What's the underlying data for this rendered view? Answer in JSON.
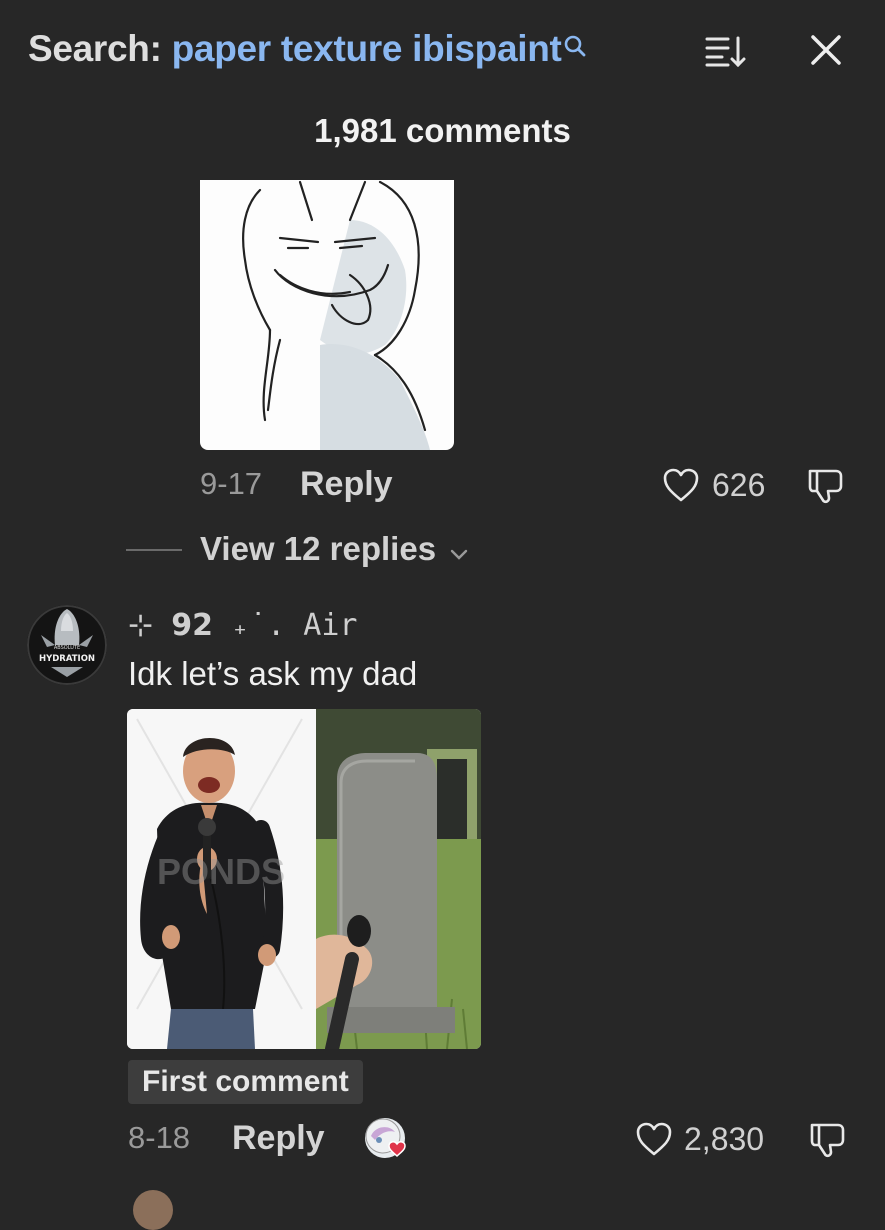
{
  "header": {
    "search_prefix": "Search:",
    "search_query": "paper texture ibispaint",
    "search_icon": "search-icon",
    "sort_icon": "sort-icon",
    "close_icon": "close-icon",
    "comment_count": "1,981 comments"
  },
  "colors": {
    "background": "#272727",
    "query_link": "#8ab7f0",
    "secondary_text": "#9a9a9a",
    "badge_bg": "#3d3d3d"
  },
  "comment1": {
    "date": "9-17",
    "reply_label": "Reply",
    "likes": "626",
    "view_replies": "View 12 replies"
  },
  "comment2": {
    "username": "⊹ 𝟵𝟮 ₊˙. Air",
    "text": "Idk let’s ask my dad",
    "avatar_text": "HYDRATION",
    "avatar_text_small": "ABSOLUTE",
    "watermark": "PONDS",
    "badge": "First comment",
    "date": "8-18",
    "reply_label": "Reply",
    "likes": "2,830"
  }
}
